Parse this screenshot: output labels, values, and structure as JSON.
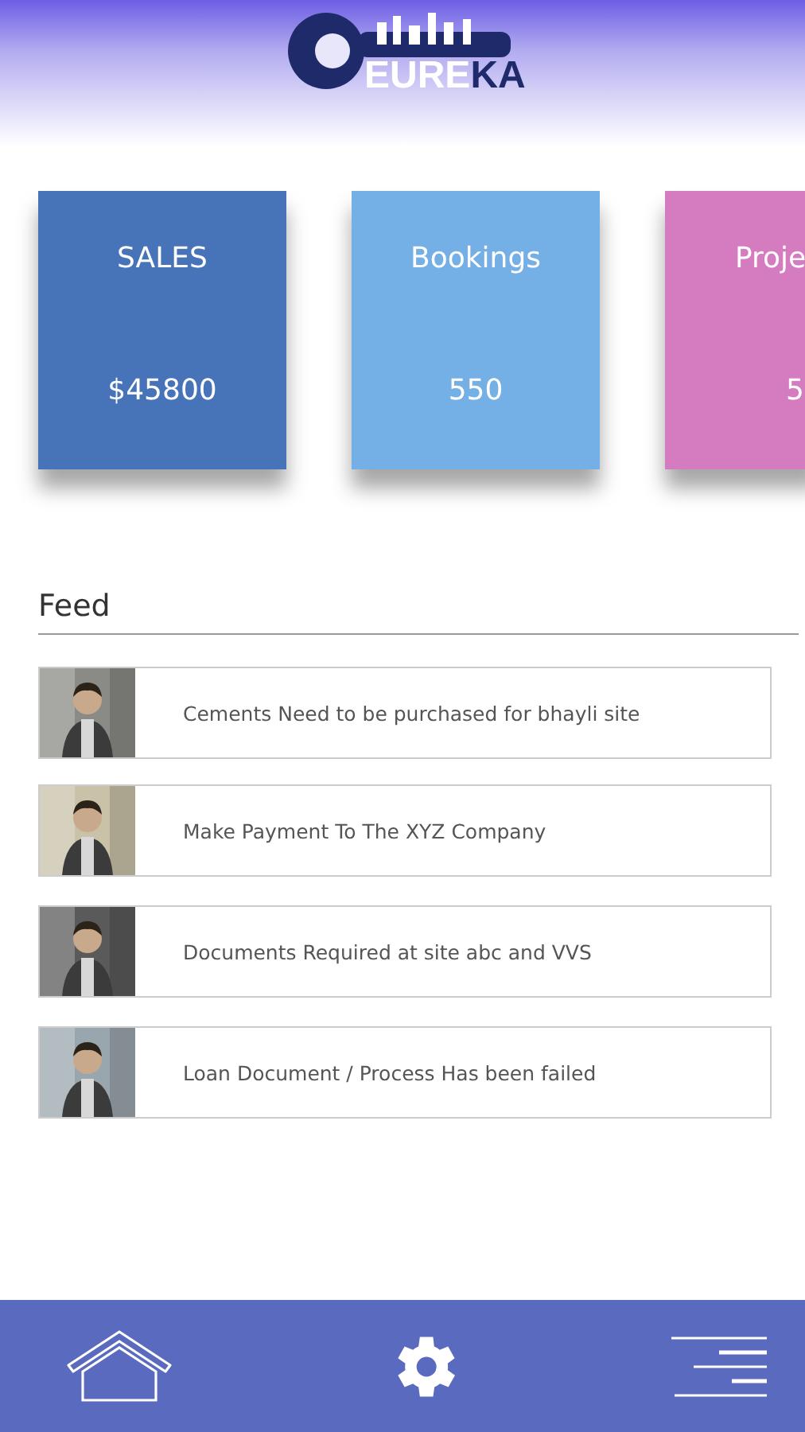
{
  "logo": {
    "text_light": "EURE",
    "text_dark": "KA"
  },
  "cards": [
    {
      "title": "SALES",
      "value": "$45800",
      "color": "#4773b9"
    },
    {
      "title": "Bookings",
      "value": "550",
      "color": "#74b0e5"
    },
    {
      "title": "Proje",
      "value": "5",
      "color": "#d57cc0"
    }
  ],
  "feed": {
    "title": "Feed",
    "items": [
      {
        "text": "Cements Need to be purchased for bhayli site"
      },
      {
        "text": "Make Payment To The XYZ Company"
      },
      {
        "text": "Documents Required at site abc and VVS"
      },
      {
        "text": "Loan Document / Process Has been failed"
      }
    ]
  },
  "nav": [
    {
      "kind": "home"
    },
    {
      "kind": "settings"
    },
    {
      "kind": "menu"
    }
  ]
}
